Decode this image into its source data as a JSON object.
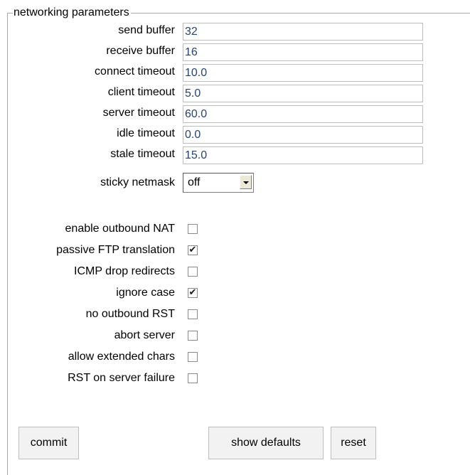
{
  "group": {
    "legend": "networking parameters"
  },
  "fields": [
    {
      "label": "send buffer",
      "value": "32"
    },
    {
      "label": "receive buffer",
      "value": "16"
    },
    {
      "label": "connect timeout",
      "value": "10.0"
    },
    {
      "label": "client timeout",
      "value": "5.0"
    },
    {
      "label": "server timeout",
      "value": "60.0"
    },
    {
      "label": "idle timeout",
      "value": "0.0"
    },
    {
      "label": "stale timeout",
      "value": "15.0"
    }
  ],
  "sticky": {
    "label": "sticky netmask",
    "value": "off"
  },
  "options": [
    {
      "label": "enable outbound NAT",
      "checked": false
    },
    {
      "label": "passive FTP translation",
      "checked": true
    },
    {
      "label": "ICMP drop redirects",
      "checked": false
    },
    {
      "label": "ignore case",
      "checked": true
    },
    {
      "label": "no outbound RST",
      "checked": false
    },
    {
      "label": "abort server",
      "checked": false
    },
    {
      "label": "allow extended chars",
      "checked": false
    },
    {
      "label": "RST on server failure",
      "checked": false
    }
  ],
  "check_mark": "✔",
  "buttons": {
    "commit": "commit",
    "show_defaults": "show defaults",
    "reset": "reset"
  },
  "colors": {
    "input_text": "#27446f",
    "border": "#a9a9a9"
  }
}
